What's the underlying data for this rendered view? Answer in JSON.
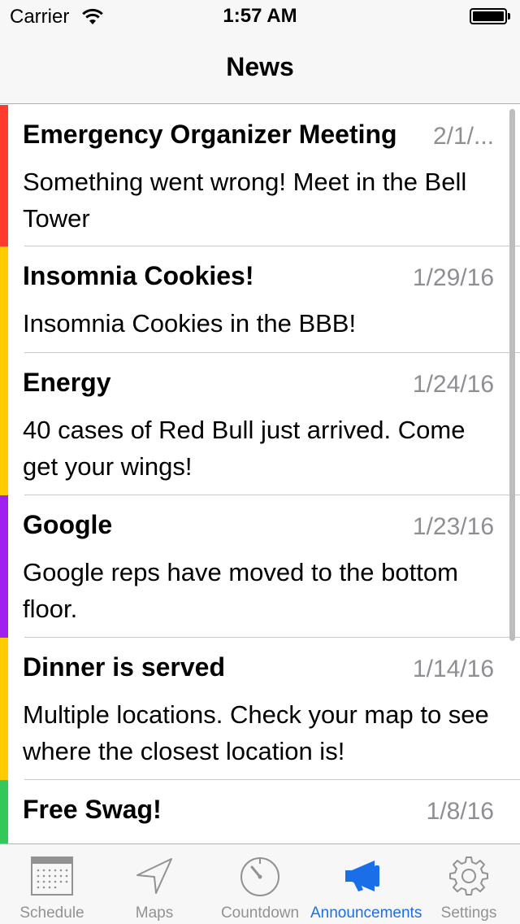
{
  "status_bar": {
    "carrier": "Carrier",
    "time": "1:57 AM"
  },
  "nav": {
    "title": "News"
  },
  "colors": {
    "red": "#ff3b30",
    "yellow": "#ffcc00",
    "purple": "#a020f0",
    "green": "#34c759",
    "accent": "#1a6fe8",
    "inactive": "#929292"
  },
  "announcements": [
    {
      "title": "Emergency Organizer Meeting",
      "date": "2/1/...",
      "body": "Something went wrong! Meet in the Bell Tower",
      "color": "red"
    },
    {
      "title": "Insomnia Cookies!",
      "date": "1/29/16",
      "body": "Insomnia Cookies in the BBB!",
      "color": "yellow"
    },
    {
      "title": "Energy",
      "date": "1/24/16",
      "body": "40 cases of Red Bull just arrived. Come get your wings!",
      "color": "yellow"
    },
    {
      "title": "Google",
      "date": "1/23/16",
      "body": "Google reps have moved to the bottom floor.",
      "color": "purple"
    },
    {
      "title": "Dinner is served",
      "date": "1/14/16",
      "body": "Multiple locations. Check your map to see where the closest location is!",
      "color": "yellow"
    },
    {
      "title": "Free Swag!",
      "date": "1/8/16",
      "body": "",
      "color": "green"
    }
  ],
  "tabs": [
    {
      "label": "Schedule",
      "icon": "calendar-icon",
      "active": false
    },
    {
      "label": "Maps",
      "icon": "location-arrow-icon",
      "active": false
    },
    {
      "label": "Countdown",
      "icon": "timer-icon",
      "active": false
    },
    {
      "label": "Announcements",
      "icon": "megaphone-icon",
      "active": true
    },
    {
      "label": "Settings",
      "icon": "gear-icon",
      "active": false
    }
  ]
}
